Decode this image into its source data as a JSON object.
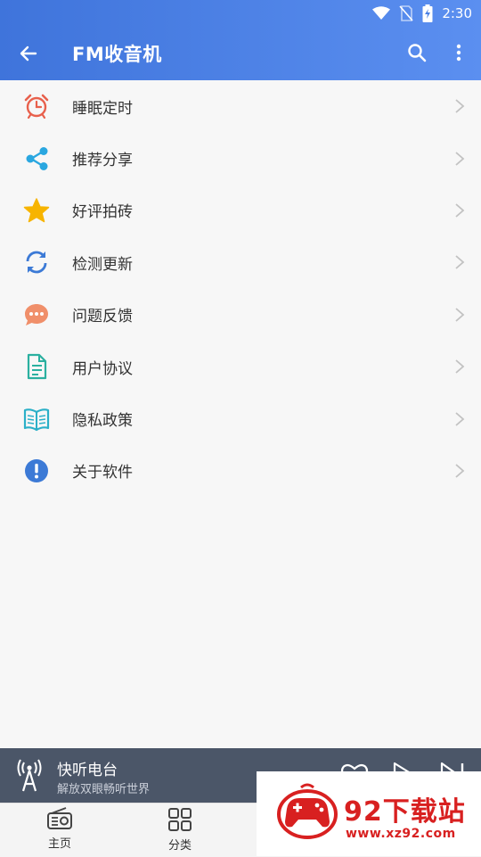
{
  "status_bar": {
    "time": "2:30"
  },
  "toolbar": {
    "title": "FM收音机"
  },
  "menu": {
    "items": [
      {
        "label": "睡眠定时",
        "icon": "alarm-clock-icon"
      },
      {
        "label": "推荐分享",
        "icon": "share-icon"
      },
      {
        "label": "好评拍砖",
        "icon": "star-icon"
      },
      {
        "label": "检测更新",
        "icon": "refresh-icon"
      },
      {
        "label": "问题反馈",
        "icon": "chat-bubble-icon"
      },
      {
        "label": "用户协议",
        "icon": "document-icon"
      },
      {
        "label": "隐私政策",
        "icon": "open-book-icon"
      },
      {
        "label": "关于软件",
        "icon": "info-icon"
      }
    ]
  },
  "player": {
    "station": "快听电台",
    "slogan": "解放双眼畅听世界"
  },
  "bottom_nav": {
    "items": [
      {
        "label": "主页"
      },
      {
        "label": "分类"
      }
    ]
  },
  "watermark": {
    "big": "92下载站",
    "url": "www.xz92.com"
  },
  "colors": {
    "toolbar_start": "#3f74db",
    "toolbar_end": "#5b8ff0",
    "player_bg": "#4b5668",
    "alarm": "#e8604c",
    "share": "#2aa7e0",
    "star": "#f7b400",
    "refresh": "#3c7ad6",
    "chat": "#f08f6a",
    "document": "#2bb0a0",
    "book": "#2bb0c8",
    "info": "#3c7ad6",
    "watermark_red": "#d82020"
  }
}
